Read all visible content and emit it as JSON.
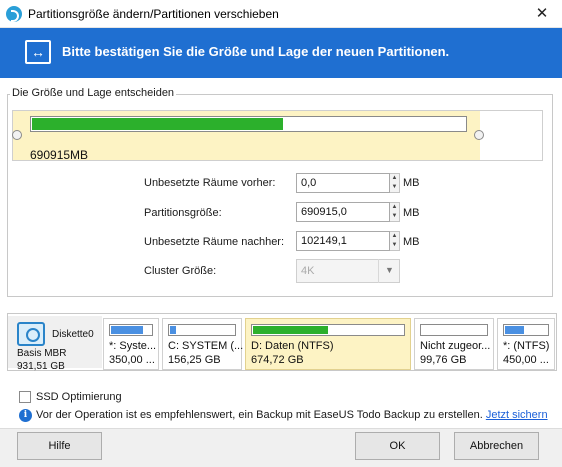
{
  "window": {
    "title": "Partitionsgröße ändern/Partitionen verschieben",
    "close_glyph": "✕"
  },
  "header": {
    "icon": "resize-arrows-icon",
    "icon_glyph": "↔",
    "text": "Bitte bestätigen Sie die Größe und Lage der neuen Partitionen."
  },
  "layout_group": {
    "legend": "Die Größe und Lage entscheiden",
    "partition_size_label": "690915MB",
    "used_fraction": 0.58
  },
  "fields": {
    "before": {
      "label": "Unbesetzte Räume vorher:",
      "value": "0,0",
      "unit": "MB"
    },
    "size": {
      "label": "Partitionsgröße:",
      "value": "690915,0",
      "unit": "MB"
    },
    "after": {
      "label": "Unbesetzte Räume nachher:",
      "value": "102149,1",
      "unit": "MB"
    },
    "cluster": {
      "label": "Cluster Größe:",
      "value": "4K"
    }
  },
  "spin_up": "▲",
  "spin_down": "▼",
  "combo_arrow": "▼",
  "disk": {
    "name": "Diskette0",
    "type": "Basis MBR",
    "size": "931,51 GB",
    "icon": "hard-disk-icon"
  },
  "partitions": [
    {
      "name": "*: Syste...",
      "size": "350,00 ...",
      "fill": 0.8,
      "color": "#4a90e2"
    },
    {
      "name": "C: SYSTEM (...",
      "size": "156,25 GB",
      "fill": 0.1,
      "color": "#4a90e2"
    },
    {
      "name": "D: Daten (NTFS)",
      "size": "674,72 GB",
      "fill": 0.5,
      "color": "#2cb02c"
    },
    {
      "name": "Nicht zugeor...",
      "size": "99,76 GB",
      "fill": 0,
      "color": "#4a90e2"
    },
    {
      "name": "*: (NTFS)",
      "size": "450,00 ...",
      "fill": 0.45,
      "color": "#4a90e2"
    }
  ],
  "ssd": {
    "label": "SSD Optimierung",
    "checked": false
  },
  "note": {
    "icon": "info-icon",
    "text": "Vor der Operation ist es empfehlenswert, ein Backup mit  EaseUS Todo Backup zu erstellen.",
    "link": "Jetzt sichern"
  },
  "buttons": {
    "help": "Hilfe",
    "ok": "OK",
    "cancel": "Abbrechen"
  },
  "colors": {
    "header_bg": "#1f6fd1",
    "selected_bg": "#fdf3c4",
    "used_fill": "#2cb02c",
    "link": "#1a5fd8"
  }
}
